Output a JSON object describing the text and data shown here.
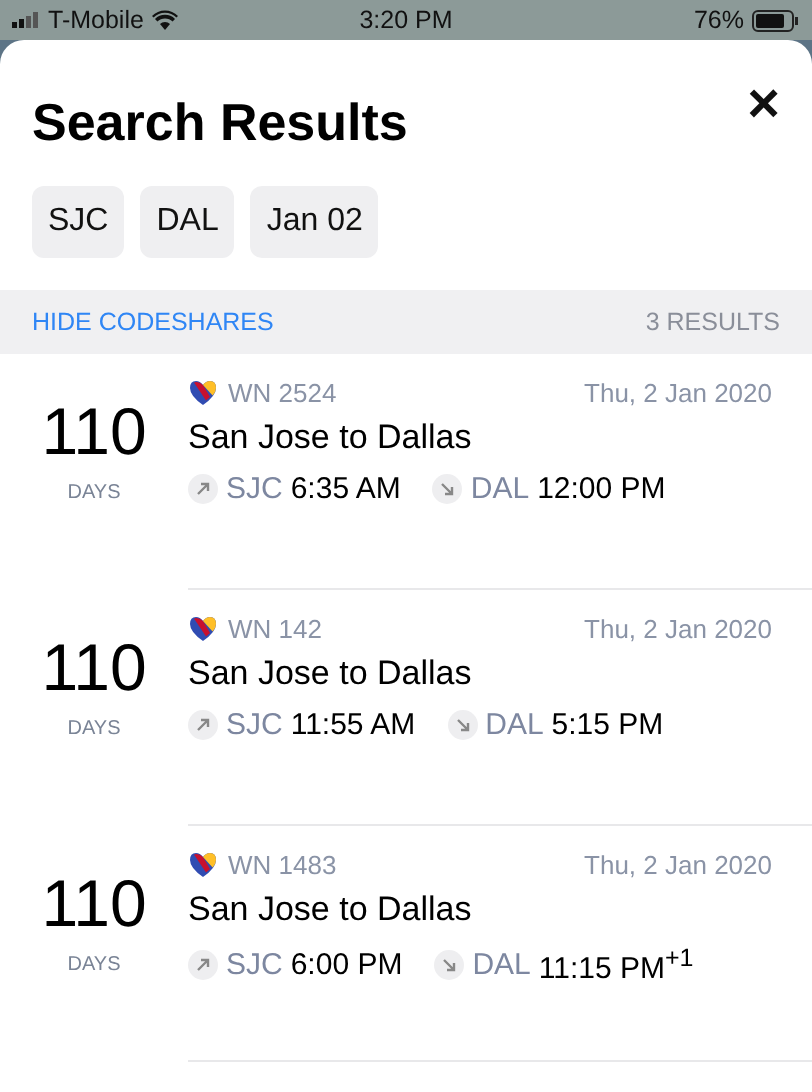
{
  "status_bar": {
    "carrier": "T-Mobile",
    "time": "3:20 PM",
    "battery": "76%"
  },
  "title": "Search Results",
  "close": "×",
  "filters": [
    "SJC",
    "DAL",
    "Jan 02"
  ],
  "toolbar": {
    "action": "HIDE CODESHARES",
    "count": "3 RESULTS"
  },
  "flights": [
    {
      "days": "110",
      "days_label": "DAYS",
      "flight": "WN 2524",
      "date": "Thu, 2 Jan 2020",
      "route": "San Jose to Dallas",
      "from": "SJC",
      "dep": "6:35 AM",
      "to": "DAL",
      "arr": "12:00 PM"
    },
    {
      "days": "110",
      "days_label": "DAYS",
      "flight": "WN 142",
      "date": "Thu, 2 Jan 2020",
      "route": "San Jose to Dallas",
      "from": "SJC",
      "dep": "11:55 AM",
      "to": "DAL",
      "arr": "5:15 PM"
    },
    {
      "days": "110",
      "days_label": "DAYS",
      "flight": "WN 1483",
      "date": "Thu, 2 Jan 2020",
      "route": "San Jose to Dallas",
      "from": "SJC",
      "dep": "6:00 PM",
      "to": "DAL",
      "arr": "11:15 PM$^{+1}$"
    }
  ]
}
